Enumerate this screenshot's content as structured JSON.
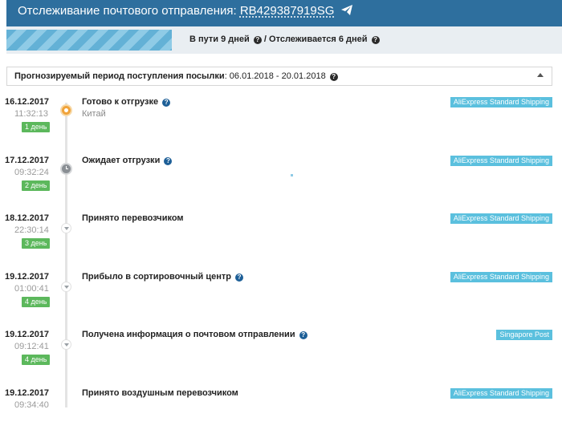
{
  "header": {
    "title_prefix": "Отслеживание почтового отправления: ",
    "tracking_number": "RB429387919SG"
  },
  "status": {
    "in_transit": "В пути 9 дней",
    "separator": " / ",
    "tracked": "Отслеживается 6 дней"
  },
  "forecast": {
    "label": "Прогнозируемый период поступления посылки",
    "value": ": 06.01.2018 - 20.01.2018"
  },
  "events": [
    {
      "date": "16.12.2017",
      "time": "11:32:13",
      "days": "1 день",
      "title": "Готово к отгрузке",
      "location": "Китай",
      "carrier": "AliExpress Standard Shipping",
      "help": true,
      "icon": "package-icon"
    },
    {
      "date": "17.12.2017",
      "time": "09:32:24",
      "days": "2 день",
      "title": "Ожидает отгрузки",
      "location": "",
      "carrier": "AliExpress Standard Shipping",
      "help": true,
      "icon": "clock-icon"
    },
    {
      "date": "18.12.2017",
      "time": "22:30:14",
      "days": "3 день",
      "title": "Принято перевозчиком",
      "location": "",
      "carrier": "AliExpress Standard Shipping",
      "help": false,
      "icon": "chevron-down-icon"
    },
    {
      "date": "19.12.2017",
      "time": "01:00:41",
      "days": "4 день",
      "title": "Прибыло в сортировочный центр",
      "location": "",
      "carrier": "AliExpress Standard Shipping",
      "help": true,
      "icon": "chevron-down-icon"
    },
    {
      "date": "19.12.2017",
      "time": "09:12:41",
      "days": "4 день",
      "title": "Получена информация о почтовом отправлении",
      "location": "",
      "carrier": "Singapore Post",
      "help": true,
      "icon": "chevron-down-icon"
    },
    {
      "date": "19.12.2017",
      "time": "09:34:40",
      "days": "",
      "title": "Принято воздушным перевозчиком",
      "location": "",
      "carrier": "AliExpress Standard Shipping",
      "help": false,
      "icon": "chevron-down-icon"
    }
  ],
  "colors": {
    "header_bg": "#2e6f9e",
    "progress": "#63b1d6",
    "days_badge": "#5cb85c",
    "carrier_badge": "#5bc0de",
    "help_icon": "#1d5f97"
  }
}
